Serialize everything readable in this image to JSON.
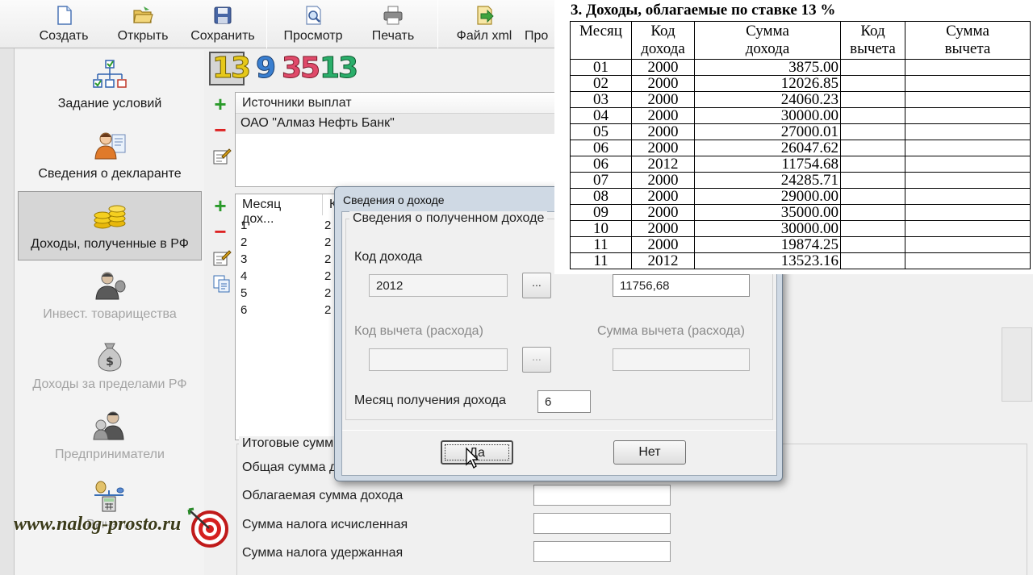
{
  "toolbar": {
    "buttons": [
      {
        "label": "Создать",
        "icon": "new-file-icon"
      },
      {
        "label": "Открыть",
        "icon": "open-folder-icon"
      },
      {
        "label": "Сохранить",
        "icon": "save-disk-icon"
      },
      {
        "label": "Просмотр",
        "icon": "preview-magnifier-icon"
      },
      {
        "label": "Печать",
        "icon": "printer-icon"
      },
      {
        "label": "Файл xml",
        "icon": "xml-file-icon"
      },
      {
        "label": "Про",
        "icon": ""
      }
    ]
  },
  "sidebar": {
    "items": [
      {
        "label": "Задание условий",
        "icon": "conditions-tree-icon",
        "enabled": true
      },
      {
        "label": "Сведения о декларанте",
        "icon": "declarant-person-icon",
        "enabled": true
      },
      {
        "label": "Доходы, полученные в РФ",
        "icon": "gold-coins-icon",
        "enabled": true,
        "active": true
      },
      {
        "label": "Инвест. товарищества",
        "icon": "investor-person-icon",
        "enabled": false
      },
      {
        "label": "Доходы за пределами РФ",
        "icon": "money-bag-icon",
        "enabled": false
      },
      {
        "label": "Предприниматели",
        "icon": "entrepreneurs-icon",
        "enabled": false
      },
      {
        "label": "Вычеты",
        "icon": "deductions-calculator-icon",
        "enabled": false
      }
    ]
  },
  "main": {
    "rate_tabs": [
      "13",
      "9",
      "35",
      "13"
    ],
    "sources": {
      "header": "Источники выплат",
      "rows": [
        "ОАО \"Алмаз Нефть Банк\""
      ]
    },
    "income": {
      "header_month": "Месяц дох...",
      "header_code": "К",
      "rows": [
        {
          "month": "1",
          "code": "2"
        },
        {
          "month": "2",
          "code": "2"
        },
        {
          "month": "3",
          "code": "2"
        },
        {
          "month": "4",
          "code": "2"
        },
        {
          "month": "5",
          "code": "2"
        },
        {
          "month": "6",
          "code": "2"
        }
      ]
    },
    "totals": {
      "title": "Итоговые сумм",
      "rows": [
        {
          "label": "Общая сумма д",
          "value": ""
        },
        {
          "label": "Облагаемая сумма дохода",
          "value": ""
        },
        {
          "label": "Сумма налога исчисленная",
          "value": ""
        },
        {
          "label": "Сумма налога удержанная",
          "value": ""
        }
      ]
    }
  },
  "dialog": {
    "title": "Сведения о доходе",
    "group_title": "Сведения о полученном доходе",
    "income_code_label": "Код дохода",
    "income_code_value": "2012",
    "income_sum_value": "11756,68",
    "deduction_code_label": "Код вычета (расхода)",
    "deduction_code_value": "",
    "deduction_sum_label": "Сумма вычета (расхода)",
    "deduction_sum_value": "",
    "month_label": "Месяц получения дохода",
    "month_value": "6",
    "ok_label": "Да",
    "cancel_label": "Нет",
    "dots_label": "..."
  },
  "paper": {
    "title": "3. Доходы, облагаемые по ставке 13 %",
    "columns": [
      {
        "line1": "Месяц",
        "line2": ""
      },
      {
        "line1": "Код",
        "line2": "дохода"
      },
      {
        "line1": "Сумма",
        "line2": "дохода"
      },
      {
        "line1": "Код",
        "line2": "вычета"
      },
      {
        "line1": "Сумма",
        "line2": "вычета"
      }
    ],
    "rows": [
      [
        "01",
        "2000",
        "3875.00",
        "",
        ""
      ],
      [
        "02",
        "2000",
        "12026.85",
        "",
        ""
      ],
      [
        "03",
        "2000",
        "24060.23",
        "",
        ""
      ],
      [
        "04",
        "2000",
        "30000.00",
        "",
        ""
      ],
      [
        "05",
        "2000",
        "27000.01",
        "",
        ""
      ],
      [
        "06",
        "2000",
        "26047.62",
        "",
        ""
      ],
      [
        "06",
        "2012",
        "11754.68",
        "",
        ""
      ],
      [
        "07",
        "2000",
        "24285.71",
        "",
        ""
      ],
      [
        "08",
        "2000",
        "29000.00",
        "",
        ""
      ],
      [
        "09",
        "2000",
        "35000.00",
        "",
        ""
      ],
      [
        "10",
        "2000",
        "30000.00",
        "",
        ""
      ],
      [
        "11",
        "2000",
        "19874.25",
        "",
        ""
      ],
      [
        "11",
        "2012",
        "13523.16",
        "",
        ""
      ]
    ]
  },
  "watermark": {
    "text": "www.nalog-prosto.ru"
  }
}
